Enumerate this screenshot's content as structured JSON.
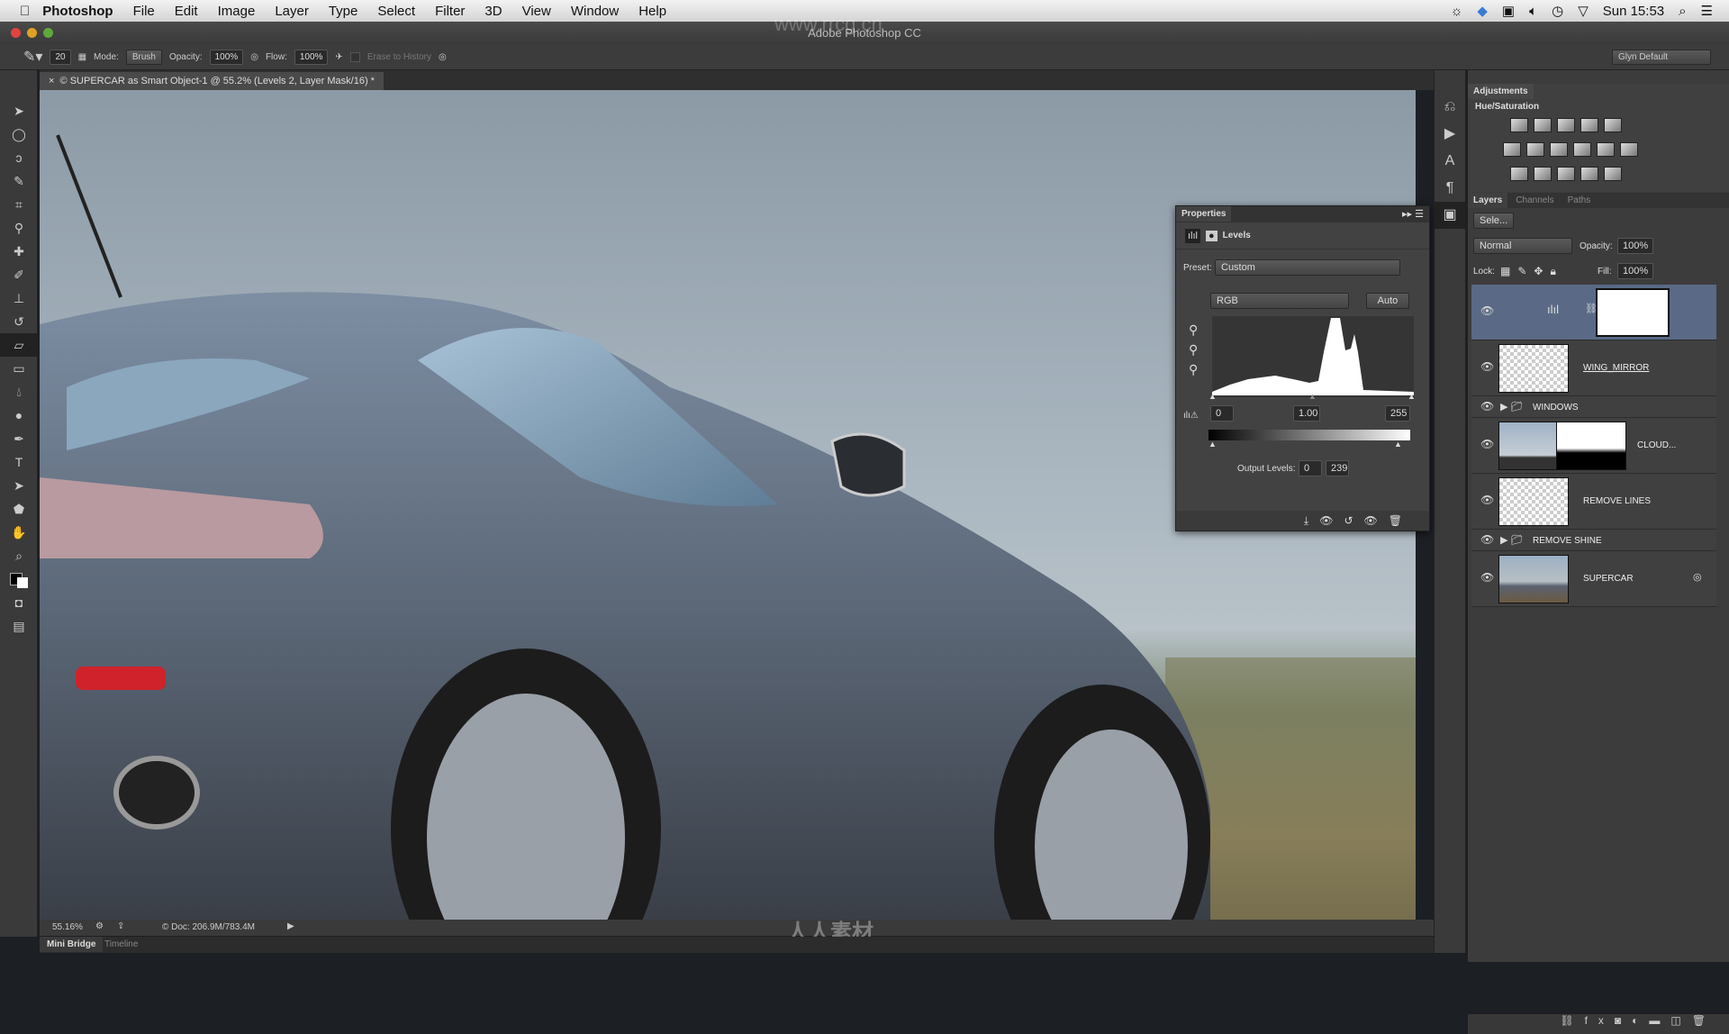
{
  "menubar": {
    "app": "Photoshop",
    "items": [
      "File",
      "Edit",
      "Image",
      "Layer",
      "Type",
      "Select",
      "Filter",
      "3D",
      "View",
      "Window",
      "Help"
    ],
    "clock": "Sun 15:53"
  },
  "window": {
    "title": "Adobe Photoshop CC",
    "watermark": "www.rrcg.cn"
  },
  "options": {
    "brush_size": "20",
    "mode_label": "Mode:",
    "mode": "Brush",
    "opacity_label": "Opacity:",
    "opacity": "100%",
    "flow_label": "Flow:",
    "flow": "100%",
    "erase_history": "Erase to History",
    "workspace": "Glyn Default"
  },
  "document": {
    "tab": "© SUPERCAR as Smart Object-1 @ 55.2% (Levels 2, Layer Mask/16) *",
    "zoom": "55.16%",
    "doc_info": "© Doc: 206.9M/783.4M"
  },
  "bottom_tabs": [
    "Mini Bridge",
    "Timeline"
  ],
  "adjustments": {
    "title": "Adjustments",
    "hover": "Hue/Saturation"
  },
  "layers_panel": {
    "tabs": [
      "Layers",
      "Channels",
      "Paths"
    ],
    "filter": "Sele...",
    "blend": "Normal",
    "opacity_label": "Opacity:",
    "opacity": "100%",
    "lock_label": "Lock:",
    "fill_label": "Fill:",
    "fill": "100%",
    "layers": [
      {
        "name": "",
        "type": "levels-adjustment",
        "selected": true
      },
      {
        "name": "WING_MIRROR",
        "type": "pixel"
      },
      {
        "name": "WINDOWS",
        "type": "group"
      },
      {
        "name": "CLOUD...",
        "type": "smart-masked"
      },
      {
        "name": "REMOVE LINES",
        "type": "pixel"
      },
      {
        "name": "REMOVE SHINE",
        "type": "group"
      },
      {
        "name": "SUPERCAR",
        "type": "smart-object"
      }
    ]
  },
  "properties": {
    "title": "Properties",
    "adjustment": "Levels",
    "preset_label": "Preset:",
    "preset": "Custom",
    "channel": "RGB",
    "auto": "Auto",
    "input_black": "0",
    "input_gamma": "1.00",
    "input_white": "255",
    "output_label": "Output Levels:",
    "output_black": "0",
    "output_white": "239"
  },
  "watermark_logo": "人人素材"
}
